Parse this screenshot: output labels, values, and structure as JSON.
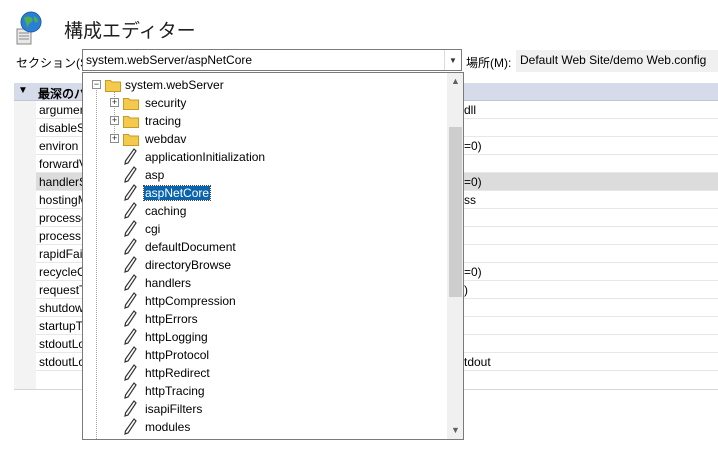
{
  "header": {
    "title": "構成エディター"
  },
  "section": {
    "label": "セクション(S):",
    "value": "system.webServer/aspNetCore",
    "location_label": "場所(M):",
    "location_value": "Default Web Site/demo Web.config"
  },
  "grid": {
    "header_label": "最深のパ",
    "rows": [
      {
        "name": "argumen",
        "value": "dll"
      },
      {
        "name": "disableS",
        "value": ""
      },
      {
        "name": "environ",
        "value": "=0)"
      },
      {
        "name": "forwardV",
        "value": ""
      },
      {
        "name": "handlerS",
        "value": "=0)"
      },
      {
        "name": "hostingM",
        "value": "ss"
      },
      {
        "name": "processe",
        "value": ""
      },
      {
        "name": "processP",
        "value": ""
      },
      {
        "name": "rapidFail",
        "value": ""
      },
      {
        "name": "recycleC",
        "value": "=0)"
      },
      {
        "name": "requestT",
        "value": ")"
      },
      {
        "name": "shutdow",
        "value": ""
      },
      {
        "name": "startupT",
        "value": ""
      },
      {
        "name": "stdoutLo",
        "value": ""
      },
      {
        "name": "stdoutLo",
        "value": "tdout"
      }
    ]
  },
  "tree": {
    "root": "system.webServer",
    "folders": [
      "security",
      "tracing",
      "webdav"
    ],
    "items": [
      "applicationInitialization",
      "asp",
      "aspNetCore",
      "caching",
      "cgi",
      "defaultDocument",
      "directoryBrowse",
      "handlers",
      "httpCompression",
      "httpErrors",
      "httpLogging",
      "httpProtocol",
      "httpRedirect",
      "httpTracing",
      "isapiFilters",
      "modules"
    ],
    "selected": "aspNetCore"
  },
  "icons": {
    "globe": "globe-config-icon",
    "folder": "folder-icon",
    "pencil": "pencil-icon",
    "expand": "expand-plus-icon",
    "collapse": "collapse-minus-icon",
    "dropdown": "chevron-down-icon"
  },
  "colors": {
    "selection": "#0a64ad",
    "grid_header": "#d6dbe9",
    "folder": "#f3c94e"
  }
}
